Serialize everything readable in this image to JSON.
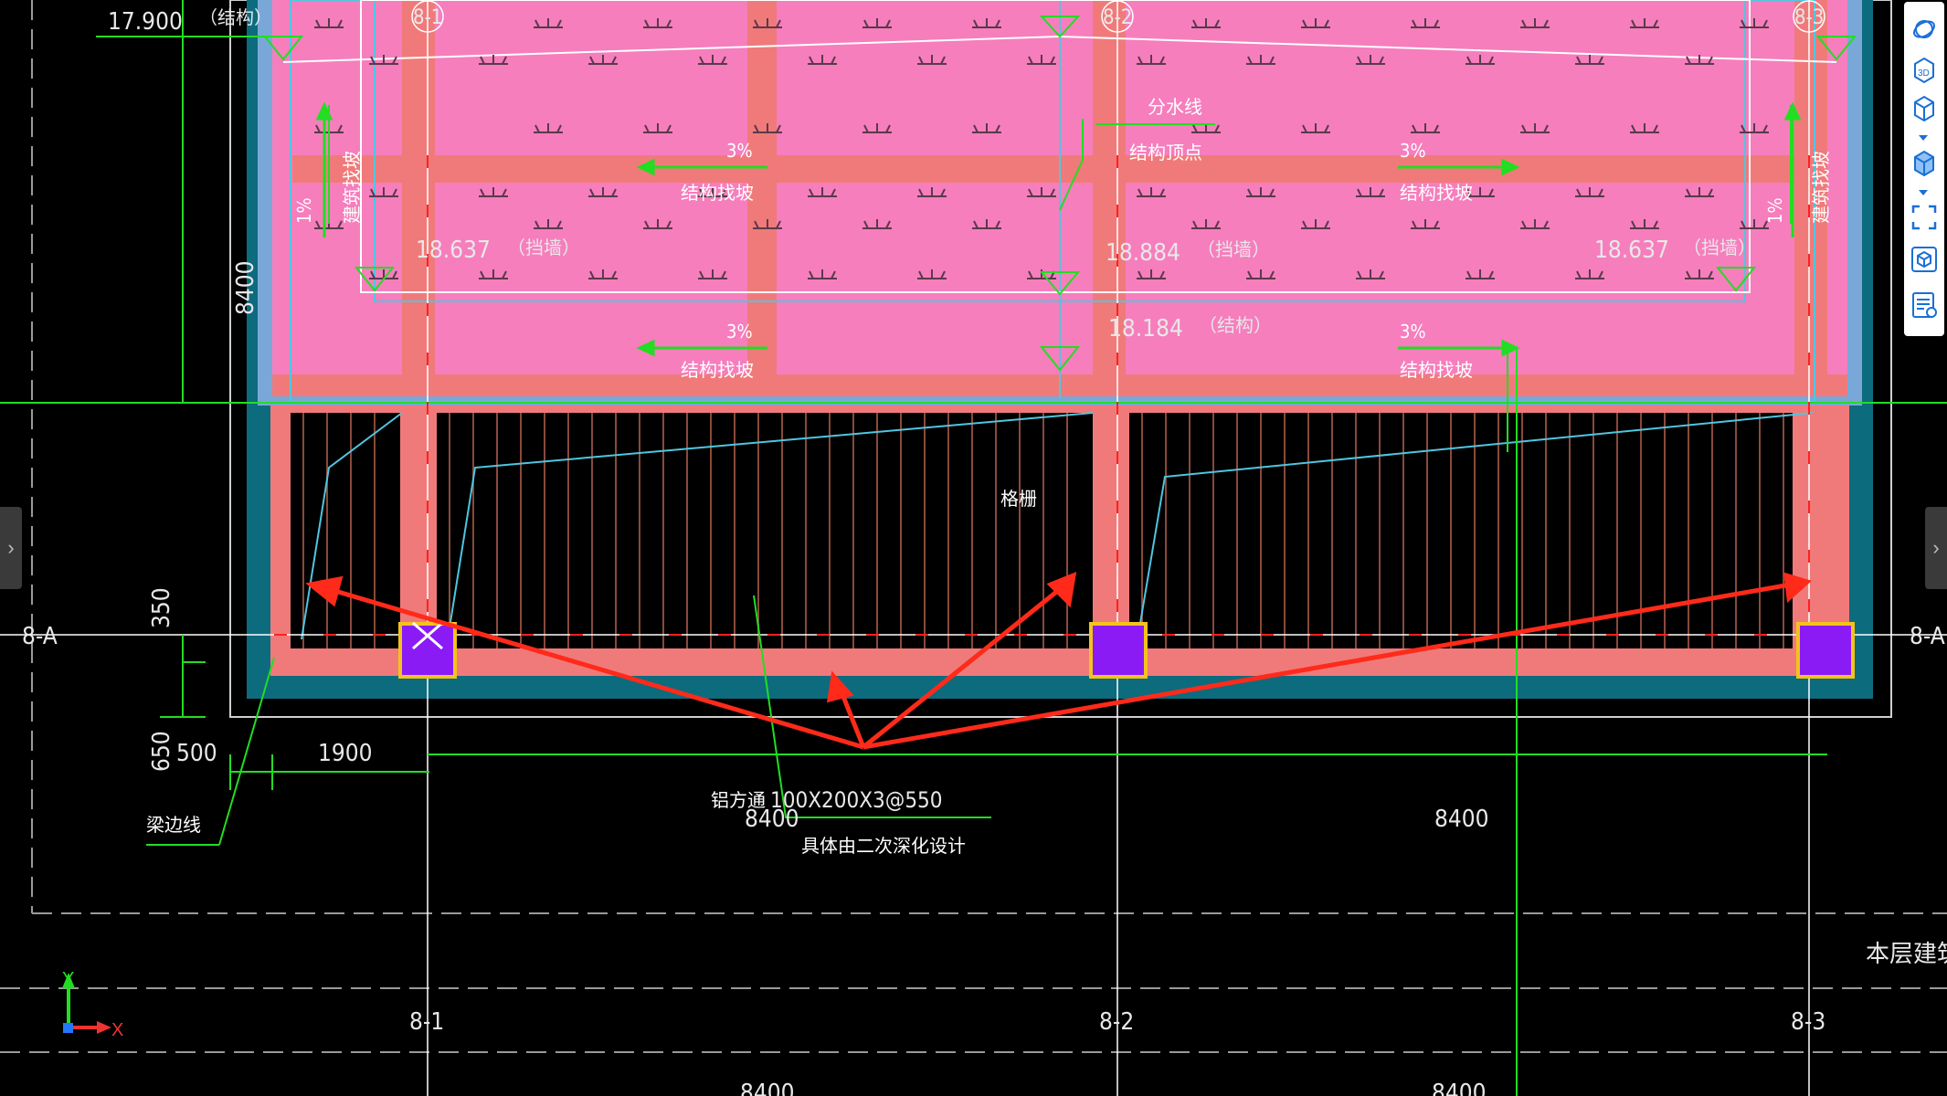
{
  "drawing": {
    "axes": {
      "row_label": "8-A",
      "columns": [
        "8-1",
        "8-2",
        "8-3"
      ]
    },
    "levels": [
      {
        "value": "17.900",
        "tag": "（结构）"
      },
      {
        "value": "18.637",
        "tag": "（挡墙）"
      },
      {
        "value": "18.884",
        "tag": "（挡墙）"
      },
      {
        "value": "18.637",
        "tag": "（挡墙）"
      },
      {
        "value": "18.184",
        "tag": "（结构）"
      }
    ],
    "slopes": {
      "pct3": "3%",
      "pct1": "1%",
      "struct_slope": "结构找坡",
      "arch_slope": "建筑找坡"
    },
    "labels": {
      "divide_line": "分水线",
      "struct_top": "结构顶点",
      "grille": "格栅",
      "beam_edge": "梁边线",
      "partial": "本层建筑面积"
    },
    "dimensions": {
      "d8400": "8400",
      "d350": "350",
      "d650": "650",
      "d500": "500",
      "d1900": "1900"
    },
    "callout": {
      "material": "铝方通",
      "spec": "100X200X3@550",
      "note": "具体由二次深化设计"
    },
    "ucs": {
      "x": "X",
      "y": "Y"
    }
  },
  "toolbar": {
    "items": [
      {
        "name": "orbit-icon"
      },
      {
        "name": "view-3d-icon",
        "text": "3D"
      },
      {
        "name": "wireframe-cube-icon"
      },
      {
        "name": "solid-cube-icon"
      },
      {
        "name": "fit-extents-icon"
      },
      {
        "name": "view-cube-icon"
      },
      {
        "name": "properties-icon"
      }
    ]
  },
  "colors": {
    "accent": "#1a6fd6",
    "roof_pink": "#f67ebd",
    "beam_salmon": "#f07a7a",
    "column_fill": "#8b1bf5",
    "column_border": "#f3c21c",
    "slab_teal": "#0d6b7e",
    "annotation_red": "#ff2a1a"
  }
}
